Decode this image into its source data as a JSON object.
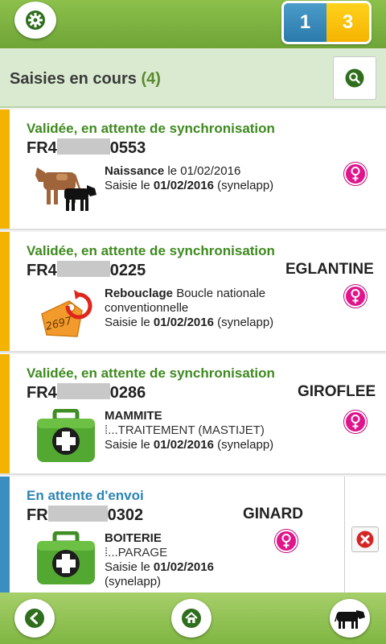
{
  "header": {
    "counter_left": "1",
    "counter_right": "3"
  },
  "titlebar": {
    "title": "Saisies en cours",
    "count": "(4)"
  },
  "cards": [
    {
      "status": "Validée, en attente de synchronisation",
      "ear_prefix": "FR4",
      "ear_suffix": "0553",
      "name": "",
      "event_type": "Naissance",
      "event_detail": " le 01/02/2016",
      "event_sub": "",
      "saisie_prefix": "Saisie le ",
      "saisie_date": "01/02/2016",
      "saisie_user": " (synelapp)",
      "icon": "cow-calf-icon"
    },
    {
      "status": "Validée, en attente de synchronisation",
      "ear_prefix": "FR4",
      "ear_suffix": "0225",
      "name": "EGLANTINE",
      "event_type": "Rebouclage",
      "event_detail": " Boucle nationale conventionnelle",
      "event_sub": "",
      "saisie_prefix": "Saisie le ",
      "saisie_date": "01/02/2016",
      "saisie_user": " (synelapp)",
      "icon": "ear-tag-icon",
      "tag_number": "2697"
    },
    {
      "status": "Validée, en attente de synchronisation",
      "ear_prefix": "FR4",
      "ear_suffix": "0286",
      "name": "GIROFLEE",
      "event_type": "MAMMITE",
      "event_detail": "",
      "event_sub": "⁞...TRAITEMENT (MASTIJET)",
      "saisie_prefix": "Saisie le ",
      "saisie_date": "01/02/2016",
      "saisie_user": " (synelapp)",
      "icon": "medical-kit-icon"
    },
    {
      "status": "En attente d'envoi",
      "ear_prefix": "FR",
      "ear_suffix": "0302",
      "name": "GINARD",
      "event_type": "BOITERIE",
      "event_detail": "",
      "event_sub": "⁞...PARAGE",
      "saisie_prefix": "Saisie le ",
      "saisie_date": "01/02/2016",
      "saisie_user": "(synelapp)",
      "icon": "medical-kit-icon"
    }
  ],
  "colors": {
    "validated_bar": "#f5b301",
    "pending_bar": "#3a8fc0",
    "validated_text": "#3e8a1f",
    "pending_text": "#2b84b5",
    "female_symbol": "#e0148b"
  }
}
